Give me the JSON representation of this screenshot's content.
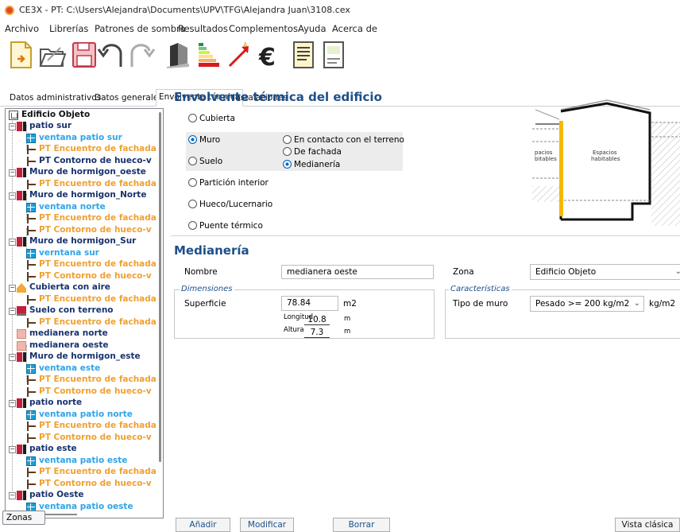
{
  "window": {
    "title": "CE3X - PT: C:\\Users\\Alejandra\\Documents\\UPV\\TFG\\Alejandra Juan\\3108.cex"
  },
  "menu": [
    "Archivo",
    "Librerías",
    "Patrones de sombra",
    "Resultados",
    "Complementos",
    "Ayuda",
    "Acerca de"
  ],
  "toolbar_icons": [
    "new-file-icon",
    "open-folder-icon",
    "save-disk-icon",
    "undo-icon",
    "redo-icon",
    "building-3d-icon",
    "energy-rating-icon",
    "improvement-arrow-icon",
    "euro-cost-icon",
    "report-document-icon",
    "certificate-document-icon"
  ],
  "tabs": [
    "Datos administrativos",
    "Datos generales",
    "Envolvente térmica",
    "Instalaciones"
  ],
  "active_tab": "Envolvente térmica",
  "tree": [
    "Edificio Objeto",
    "patio sur",
    "ventana patio sur",
    "PT Encuentro de fachada",
    "PT Contorno de hueco-v",
    "Muro de hormigon_oeste",
    "PT Encuentro de fachada",
    "Muro de hormigon_Norte",
    "ventana norte",
    "PT Encuentro de fachada",
    "PT Contorno de hueco-v",
    "Muro de hormigon_Sur",
    "verntana sur",
    "PT Encuentro de fachada",
    "PT Contorno de hueco-v",
    "Cubierta con aire",
    "PT Encuentro de fachada",
    "Suelo con terreno",
    "PT Encuentro de fachada",
    "medianera norte",
    "medianera oeste",
    "Muro de hormigon_este",
    "ventana este",
    "PT Encuentro de fachada",
    "PT Contorno de hueco-v",
    "patio norte",
    "ventana patio norte",
    "PT Encuentro de fachada",
    "PT Contorno de hueco-v",
    "patio este",
    "ventana patio este",
    "PT Encuentro de fachada",
    "PT Contorno de hueco-v",
    "patio Oeste",
    "ventana patio oeste"
  ],
  "zonas_button": "Zonas",
  "envolvente": {
    "title": "Envolvente térmica del edificio",
    "options": [
      "Cubierta",
      "Muro",
      "Suelo",
      "Partición interior",
      "Hueco/Lucernario",
      "Puente térmico"
    ],
    "selected": "Muro",
    "muro_options": [
      "En contacto con el terreno",
      "De fachada",
      "Medianería"
    ],
    "muro_selected": "Medianería"
  },
  "diagram": {
    "left_label": [
      "pacios",
      "bitables"
    ],
    "right_label": [
      "Espacios",
      "habitables"
    ]
  },
  "medianeria": {
    "title": "Medianería",
    "nombre_label": "Nombre",
    "nombre_value": "medianera oeste",
    "zona_label": "Zona",
    "zona_value": "Edificio Objeto",
    "dimensiones_legend": "Dimensiones",
    "superficie_label": "Superficie",
    "superficie_value": "78.84",
    "superficie_unit": "m2",
    "longitud_label": "Longitud",
    "longitud_value": "10.8",
    "longitud_unit": "m",
    "altura_label": "Altura",
    "altura_value": "7.3",
    "altura_unit": "m",
    "caracteristicas_legend": "Características",
    "tipo_label": "Tipo de muro",
    "tipo_value": "Pesado >= 200 kg/m2",
    "tipo_unit": "kg/m2"
  },
  "buttons": {
    "anadir": "Añadir",
    "modificar": "Modificar",
    "borrar": "Borrar",
    "vista": "Vista clásica"
  },
  "colors": {
    "heading": "#1d4f8a",
    "tree_dark": "#18326e",
    "tree_blue": "#2fa4e7",
    "tree_orange": "#f0a030",
    "wall_yellow": "#f5b800"
  }
}
